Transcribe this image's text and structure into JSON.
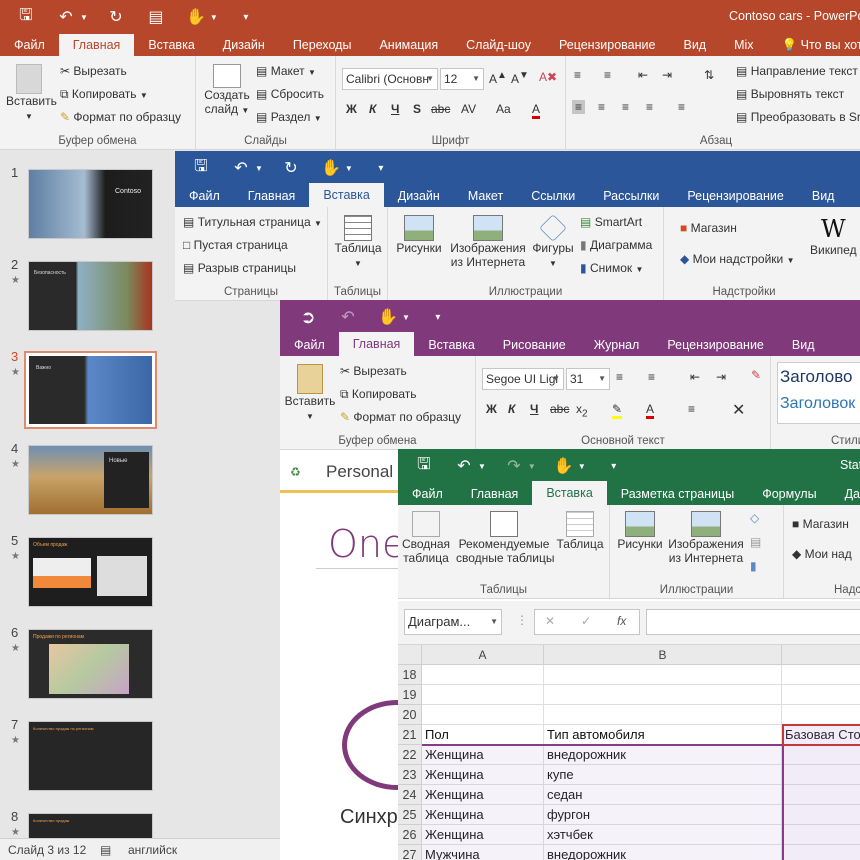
{
  "powerpoint": {
    "title": "Contoso cars - PowerPoi",
    "tabs": [
      "Файл",
      "Главная",
      "Вставка",
      "Дизайн",
      "Переходы",
      "Анимация",
      "Слайд-шоу",
      "Рецензирование",
      "Вид",
      "Mix"
    ],
    "tell_me": "Что вы хотите",
    "clipboard": {
      "paste": "Вставить",
      "cut": "Вырезать",
      "copy": "Копировать",
      "format_painter": "Формат по образцу",
      "group": "Буфер обмена"
    },
    "slides": {
      "new_slide": "Создать",
      "new_slide2": "слайд",
      "layout": "Макет",
      "reset": "Сбросить",
      "section": "Раздел",
      "group": "Слайды"
    },
    "font": {
      "name": "Calibri (Основн",
      "size": "12",
      "group": "Шрифт"
    },
    "paragraph": {
      "direction": "Направление текст",
      "align": "Выровнять текст",
      "convert": "Преобразовать в Sr",
      "group": "Абзац"
    },
    "status": {
      "slide": "Слайд 3 из 12",
      "lang": "английск"
    },
    "slide_numbers": [
      "1",
      "2",
      "3",
      "4",
      "5",
      "6",
      "7",
      "8"
    ],
    "thumb_texts": [
      "Contoso",
      "Безопасность",
      "Важно",
      "Новые",
      "Объем продаж",
      "Продажи по регионам",
      "Количество продаж по регионам",
      "Количество продаж"
    ]
  },
  "word": {
    "tabs": [
      "Файл",
      "Главная",
      "Вставка",
      "Дизайн",
      "Макет",
      "Ссылки",
      "Рассылки",
      "Рецензирование",
      "Вид"
    ],
    "pages": {
      "cover": "Титульная страница",
      "blank": "Пустая страница",
      "break": "Разрыв страницы",
      "group": "Страницы"
    },
    "tables": {
      "table": "Таблица",
      "group": "Таблицы"
    },
    "illustrations": {
      "pictures": "Рисунки",
      "online1": "Изображения",
      "online2": "из Интернета",
      "shapes": "Фигуры",
      "smartart": "SmartArt",
      "chart": "Диаграмма",
      "screenshot": "Снимок",
      "group": "Иллюстрации"
    },
    "addins": {
      "store": "Магазин",
      "my": "Мои надстройки",
      "wiki": "Википед",
      "group": "Надстройки"
    }
  },
  "onenote": {
    "tabs": [
      "Файл",
      "Главная",
      "Вставка",
      "Рисование",
      "Журнал",
      "Рецензирование",
      "Вид"
    ],
    "clipboard": {
      "paste": "Вставить",
      "cut": "Вырезать",
      "copy": "Копировать",
      "format_painter": "Формат по образцу",
      "group": "Буфер обмена"
    },
    "text": {
      "font": "Segoe UI Ligl",
      "size": "31",
      "group": "Основной текст"
    },
    "styles": {
      "h1": "Заголово",
      "h2": "Заголовок",
      "group": "Стили"
    },
    "notebook_tab": "Personal",
    "page_title": "One",
    "sync_text": "Синхр"
  },
  "excel": {
    "title": "Stat",
    "tabs": [
      "Файл",
      "Главная",
      "Вставка",
      "Разметка страницы",
      "Формулы",
      "Данн"
    ],
    "tables": {
      "pivot1": "Сводная",
      "pivot2": "таблица",
      "rec1": "Рекомендуемые",
      "rec2": "сводные таблицы",
      "table": "Таблица",
      "group": "Таблицы"
    },
    "illustrations": {
      "pictures": "Рисунки",
      "online1": "Изображения",
      "online2": "из Интернета",
      "group": "Иллюстрации"
    },
    "addins": {
      "store": "Магазин",
      "my": "Мои над",
      "group": "Надс"
    },
    "namebox": "Диаграм...",
    "fx": "fx",
    "columns": [
      "A",
      "B"
    ],
    "rows": [
      {
        "n": "18",
        "a": "",
        "b": "",
        "c": ""
      },
      {
        "n": "19",
        "a": "",
        "b": "",
        "c": ""
      },
      {
        "n": "20",
        "a": "",
        "b": "",
        "c": ""
      },
      {
        "n": "21",
        "a": "Пол",
        "b": "Тип автомобиля",
        "c": "Базовая Сто"
      },
      {
        "n": "22",
        "a": "Женщина",
        "b": "внедорожник",
        "c": ""
      },
      {
        "n": "23",
        "a": "Женщина",
        "b": "купе",
        "c": ""
      },
      {
        "n": "24",
        "a": "Женщина",
        "b": "седан",
        "c": ""
      },
      {
        "n": "25",
        "a": "Женщина",
        "b": "фургон",
        "c": ""
      },
      {
        "n": "26",
        "a": "Женщина",
        "b": "хэтчбек",
        "c": ""
      },
      {
        "n": "27",
        "a": "Мужчина",
        "b": "внедорожник",
        "c": ""
      }
    ]
  },
  "colors": {
    "ppt": "#b7472a",
    "word": "#2b579a",
    "onenote": "#80397b",
    "excel": "#217346"
  }
}
